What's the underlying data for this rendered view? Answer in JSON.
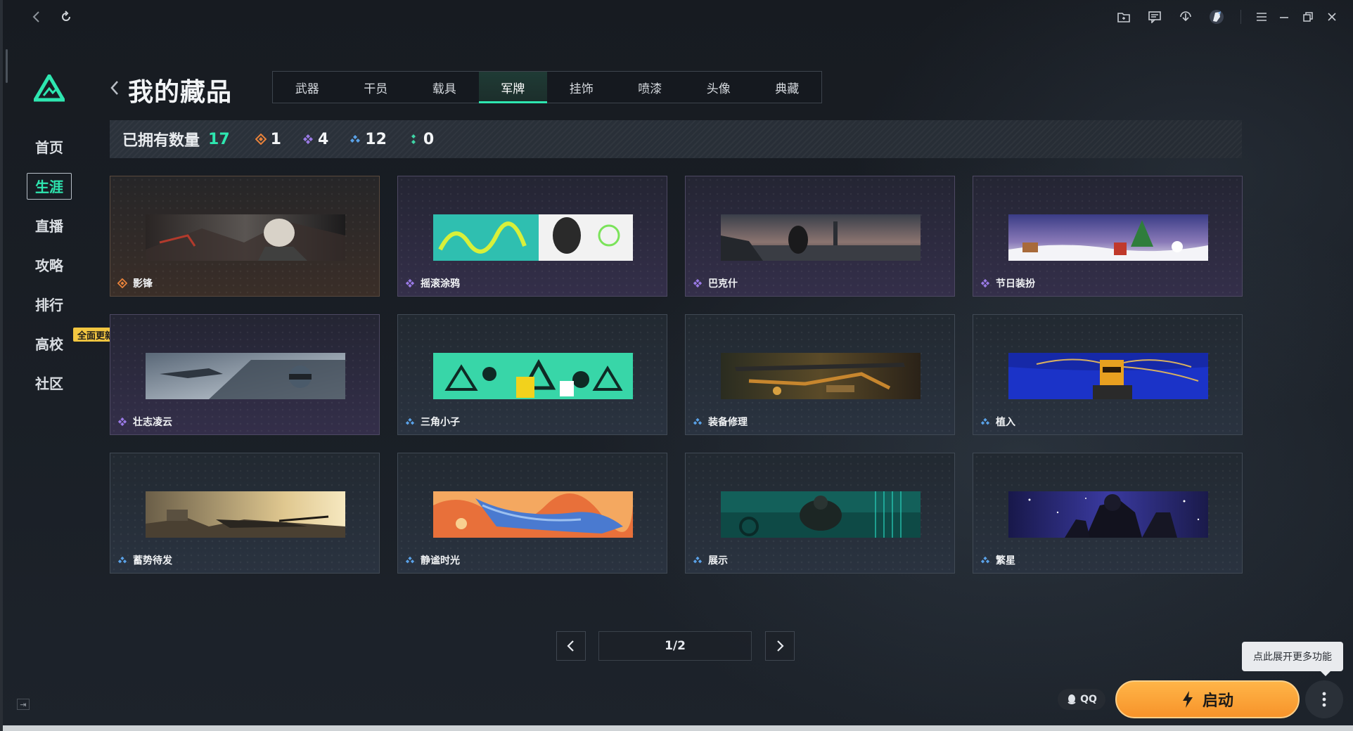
{
  "window": {
    "icons": [
      "back-icon",
      "refresh-icon",
      "folder-icon",
      "message-icon",
      "download-icon",
      "avatar-icon",
      "menu-icon",
      "minimize-icon",
      "restore-icon",
      "close-icon"
    ]
  },
  "sidebar": {
    "items": [
      {
        "label": "首页"
      },
      {
        "label": "生涯"
      },
      {
        "label": "直播"
      },
      {
        "label": "攻略"
      },
      {
        "label": "排行"
      },
      {
        "label": "高校"
      },
      {
        "label": "社区"
      }
    ],
    "active_index": 1,
    "badge": "全面更新"
  },
  "header": {
    "title": "我的藏品",
    "tabs": [
      {
        "label": "武器"
      },
      {
        "label": "干员"
      },
      {
        "label": "载具"
      },
      {
        "label": "军牌"
      },
      {
        "label": "挂饰"
      },
      {
        "label": "喷漆"
      },
      {
        "label": "头像"
      },
      {
        "label": "典藏"
      }
    ],
    "active_tab": 3
  },
  "stats": {
    "owned_label": "已拥有数量",
    "owned_count": "17",
    "rarity": [
      {
        "name": "legend",
        "count": "1",
        "color": "#e8823a"
      },
      {
        "name": "epic",
        "count": "4",
        "color": "#9a7ae6"
      },
      {
        "name": "rare",
        "count": "12",
        "color": "#5aa2e8"
      },
      {
        "name": "common",
        "count": "0",
        "color": "#3fd6a6"
      }
    ]
  },
  "cards": [
    {
      "name": "影锋",
      "rarity": "legend"
    },
    {
      "name": "摇滚涂鸦",
      "rarity": "epic"
    },
    {
      "name": "巴克什",
      "rarity": "epic"
    },
    {
      "name": "节日装扮",
      "rarity": "epic"
    },
    {
      "name": "壮志凌云",
      "rarity": "epic"
    },
    {
      "name": "三角小子",
      "rarity": "rare"
    },
    {
      "name": "装备修理",
      "rarity": "rare"
    },
    {
      "name": "植入",
      "rarity": "rare"
    },
    {
      "name": "蓄势待发",
      "rarity": "rare"
    },
    {
      "name": "静谧时光",
      "rarity": "rare"
    },
    {
      "name": "展示",
      "rarity": "rare"
    },
    {
      "name": "繁星",
      "rarity": "rare"
    }
  ],
  "pagination": {
    "label": "1/2"
  },
  "footer": {
    "tooltip": "点此展开更多功能",
    "qq_label": "QQ",
    "launch_label": "启动"
  },
  "colors": {
    "accent": "#2ee6b0",
    "launch": "#f7932a",
    "badge": "#f2c640"
  }
}
